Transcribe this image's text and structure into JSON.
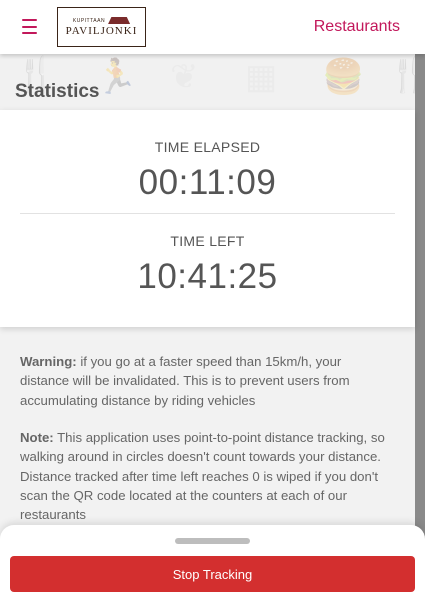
{
  "header": {
    "logo_top_text": "KUPITTAAN",
    "logo_main_text": "PAVILJONKI",
    "nav_link": "Restaurants"
  },
  "colors": {
    "accent": "#c2185b",
    "danger": "#d32f2f"
  },
  "statistics": {
    "title": "Statistics",
    "elapsed_label": "TIME ELAPSED",
    "elapsed_value": "00:11:09",
    "left_label": "TIME LEFT",
    "left_value": "10:41:25"
  },
  "notes": {
    "warning_label": "Warning:",
    "warning_text": " if you go at a faster speed than 15km/h, your distance will be invalidated. This is to prevent users from accumulating distance by riding vehicles",
    "note_label": "Note:",
    "note_text": " This application uses point-to-point distance tracking, so walking around in circles doesn't count towards your distance. Distance tracked after time left reaches 0 is wiped if you don't scan the QR code located at the counters at each of our restaurants"
  },
  "bottom_sheet": {
    "stop_button": "Stop Tracking"
  },
  "background_icons": [
    "fork-knife-icon",
    "runner-icon",
    "leaf-icon",
    "qr-code-icon",
    "fast-food-icon",
    "fork-knife-icon"
  ]
}
